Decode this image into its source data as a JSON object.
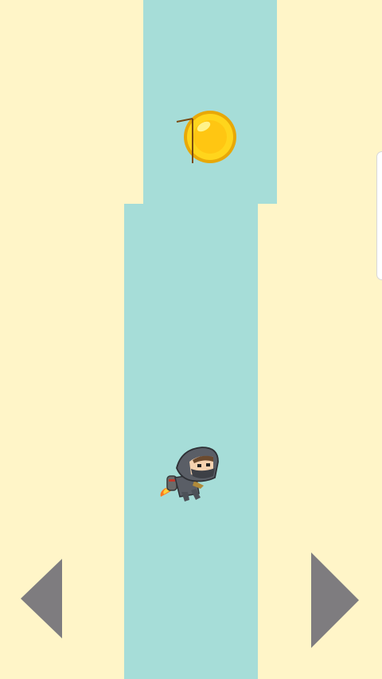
{
  "game": {
    "colors": {
      "background": "#FFF5C8",
      "track": "#A6DDD8",
      "control": "#7E7C7F",
      "coin": "#FFD51C"
    },
    "track_segments": [
      {
        "segment": "upper"
      },
      {
        "segment": "lower"
      }
    ],
    "collectibles": [
      {
        "type": "coin",
        "icon": "gold-coin-icon"
      }
    ],
    "player": {
      "character": "hooded-ninja",
      "equipment": "jetpack"
    },
    "controls": {
      "left": {
        "icon": "left-triangle-arrow-icon"
      },
      "right": {
        "icon": "right-triangle-arrow-icon"
      }
    }
  }
}
